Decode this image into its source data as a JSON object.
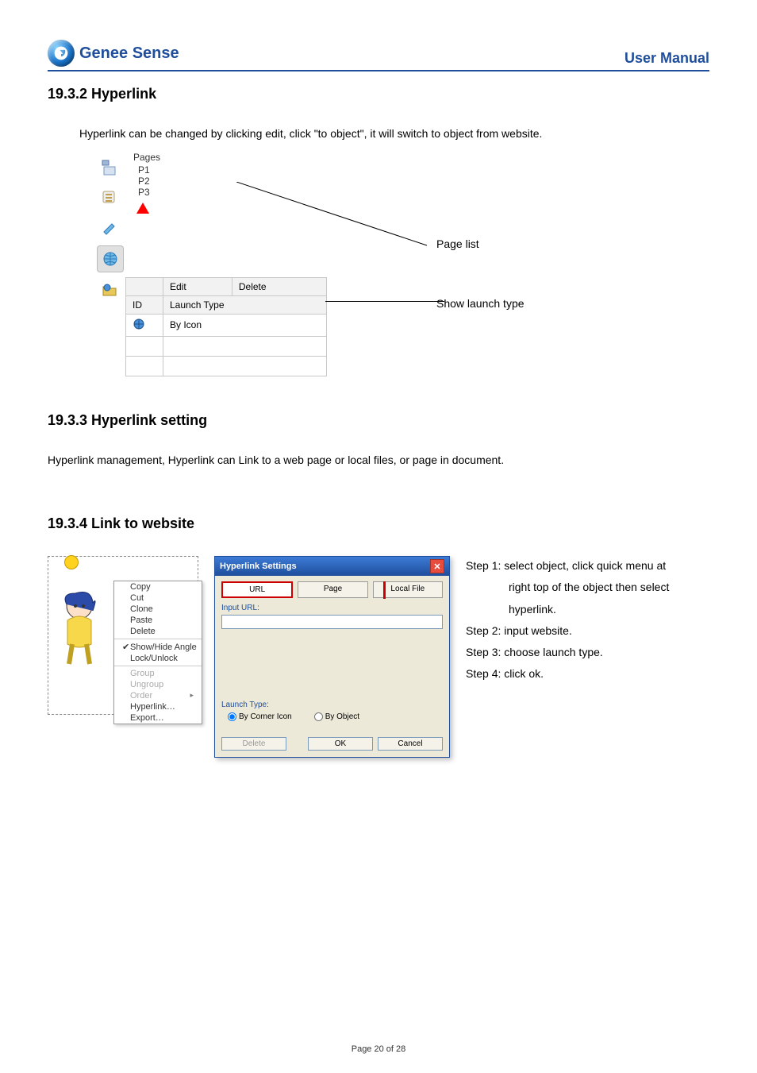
{
  "header": {
    "brand": "Genee Sense",
    "manual": "User Manual"
  },
  "sections": {
    "s1932": {
      "title": "19.3.2 Hyperlink",
      "intro": "Hyperlink can be changed by clicking edit, click \"to object\", it will switch to object from website."
    },
    "s1933": {
      "title": "19.3.3  Hyperlink setting",
      "intro": "Hyperlink management, Hyperlink can Link to a web page or local files, or page in document."
    },
    "s1934": {
      "title": "19.3.4 Link to website"
    }
  },
  "fig1": {
    "pages_header": "Pages",
    "pages": [
      "P1",
      "P2",
      "P3"
    ],
    "edit_btn": "Edit",
    "delete_btn": "Delete",
    "cols": {
      "id": "ID",
      "launch": "Launch Type"
    },
    "row1_launch": "By Icon",
    "label_pagelist": "Page list",
    "label_launch": "Show launch type"
  },
  "ctx": {
    "items": {
      "copy": "Copy",
      "cut": "Cut",
      "clone": "Clone",
      "paste": "Paste",
      "delete": "Delete",
      "showhide": "Show/Hide Angle",
      "lock": "Lock/Unlock",
      "group": "Group",
      "ungroup": "Ungroup",
      "order": "Order",
      "hyperlink": "Hyperlink…",
      "export": "Export…"
    }
  },
  "dlg": {
    "title": "Hyperlink Settings",
    "tabs": {
      "url": "URL",
      "page": "Page",
      "file": "Local File"
    },
    "input_label": "Input URL:",
    "launch_label": "Launch Type:",
    "radio_icon": "By Corner Icon",
    "radio_obj": "By Object",
    "btn_delete": "Delete",
    "btn_ok": "OK",
    "btn_cancel": "Cancel"
  },
  "steps": {
    "s1a": "Step 1: select object, click quick menu at",
    "s1b": "right top of the object then select",
    "s1c": "hyperlink.",
    "s2": "Step 2: input website.",
    "s3": "Step 3: choose launch type.",
    "s4": "Step 4: click ok."
  },
  "footer": "Page 20 of 28"
}
